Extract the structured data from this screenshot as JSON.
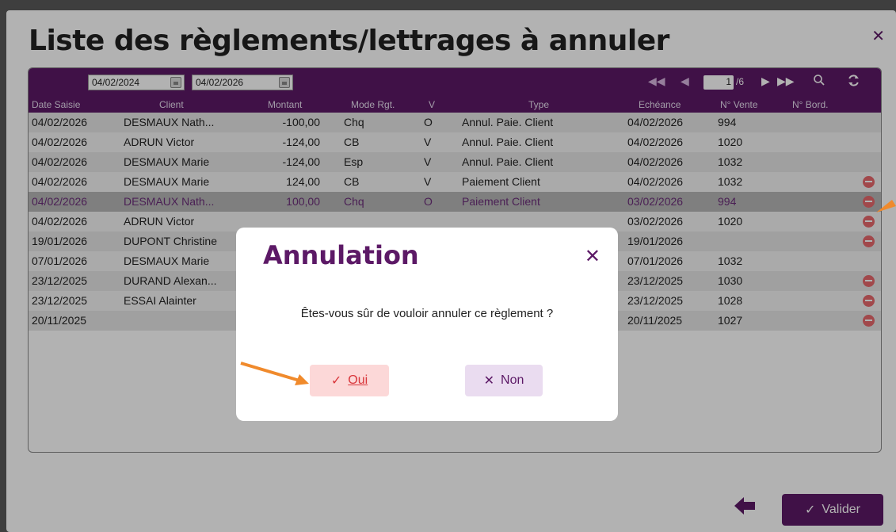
{
  "window": {
    "title": "Liste des règlements/lettrages à annuler"
  },
  "toolbar": {
    "date_from": "04/02/2024",
    "date_to": "04/02/2026",
    "page_current": "1",
    "page_total": "/6"
  },
  "columns": {
    "date": "Date Saisie",
    "client": "Client",
    "montant": "Montant",
    "mode": "Mode Rgt.",
    "v": "V",
    "type": "Type",
    "echeance": "Echéance",
    "vente": "N° Vente",
    "bord": "N° Bord."
  },
  "rows": [
    {
      "date": "04/02/2026",
      "client": "DESMAUX Nath...",
      "montant": "-100,00",
      "mode": "Chq",
      "v": "O",
      "type": "Annul. Paie. Client",
      "echeance": "04/02/2026",
      "vente": "994"
    },
    {
      "date": "04/02/2026",
      "client": "ADRUN Victor",
      "montant": "-124,00",
      "mode": "CB",
      "v": "V",
      "type": "Annul. Paie. Client",
      "echeance": "04/02/2026",
      "vente": "1020"
    },
    {
      "date": "04/02/2026",
      "client": "DESMAUX Marie",
      "montant": "-124,00",
      "mode": "Esp",
      "v": "V",
      "type": "Annul. Paie. Client",
      "echeance": "04/02/2026",
      "vente": "1032"
    },
    {
      "date": "04/02/2026",
      "client": "DESMAUX Marie",
      "montant": "124,00",
      "mode": "CB",
      "v": "V",
      "type": "Paiement Client",
      "echeance": "04/02/2026",
      "vente": "1032"
    },
    {
      "date": "04/02/2026",
      "client": "DESMAUX Nath...",
      "montant": "100,00",
      "mode": "Chq",
      "v": "O",
      "type": "Paiement Client",
      "echeance": "03/02/2026",
      "vente": "994"
    },
    {
      "date": "04/02/2026",
      "client": "ADRUN Victor",
      "montant": "",
      "mode": "",
      "v": "",
      "type": "",
      "echeance": "03/02/2026",
      "vente": "1020"
    },
    {
      "date": "19/01/2026",
      "client": "DUPONT Christine",
      "montant": "",
      "mode": "",
      "v": "",
      "type": "",
      "echeance": "19/01/2026",
      "vente": ""
    },
    {
      "date": "07/01/2026",
      "client": "DESMAUX Marie",
      "montant": "",
      "mode": "",
      "v": "",
      "type": "",
      "echeance": "07/01/2026",
      "vente": "1032"
    },
    {
      "date": "23/12/2025",
      "client": "DURAND Alexan...",
      "montant": "",
      "mode": "",
      "v": "",
      "type": "",
      "echeance": "23/12/2025",
      "vente": "1030"
    },
    {
      "date": "23/12/2025",
      "client": "ESSAI Alainter",
      "montant": "",
      "mode": "",
      "v": "",
      "type": "",
      "echeance": "23/12/2025",
      "vente": "1028"
    },
    {
      "date": "20/11/2025",
      "client": "",
      "montant": "",
      "mode": "",
      "v": "",
      "type": "",
      "echeance": "20/11/2025",
      "vente": "1027"
    }
  ],
  "footer": {
    "valider_label": "Valider"
  },
  "dialog": {
    "title": "Annulation",
    "message": "Êtes-vous sûr de vouloir annuler ce règlement ?",
    "yes_label": "Oui",
    "no_label": "Non"
  },
  "colors": {
    "brand": "#5c1966",
    "danger": "#e7686c",
    "annotation": "#f08a2c"
  }
}
